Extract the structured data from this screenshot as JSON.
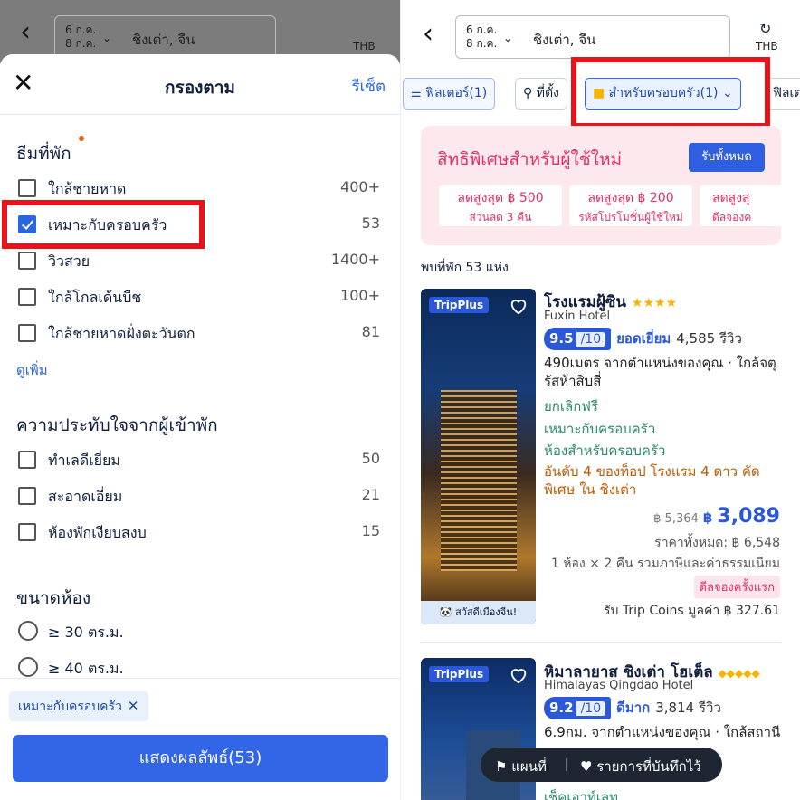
{
  "left": {
    "header": {
      "back": "‹",
      "date_line1": "6 ก.ค.",
      "date_line2": "8 ก.ค.",
      "city": "ชิงเต่า, จีน",
      "currency": "THB"
    },
    "sheet": {
      "title": "กรองตาม",
      "reset": "รีเซ็ต",
      "close": "✕",
      "theme": {
        "title": "ธีมที่พัก",
        "items": [
          {
            "label": "ใกล้ชายหาด",
            "count": "400+",
            "checked": false
          },
          {
            "label": "เหมาะกับครอบครัว",
            "count": "53",
            "checked": true
          },
          {
            "label": "วิวสวย",
            "count": "1400+",
            "checked": false
          },
          {
            "label": "ใกล้โกลเด้นบีช",
            "count": "100+",
            "checked": false
          },
          {
            "label": "ใกล้ชายหาดฝั่งตะวันตก",
            "count": "81",
            "checked": false
          }
        ],
        "more": "ดูเพิ่ม"
      },
      "impression": {
        "title": "ความประทับใจจากผู้เข้าพัก",
        "items": [
          {
            "label": "ทำเลดีเยี่ยม",
            "count": "50"
          },
          {
            "label": "สะอาดเอี่ยม",
            "count": "21"
          },
          {
            "label": "ห้องพักเงียบสงบ",
            "count": "15"
          }
        ]
      },
      "room_size": {
        "title": "ขนาดห้อง",
        "items": [
          {
            "label": "≥ 30 ตร.ม."
          },
          {
            "label": "≥ 40 ตร.ม."
          }
        ]
      },
      "selected_chip": {
        "label": "เหมาะกับครอบครัว",
        "remove": "✕"
      },
      "show_button": "แสดงผลลัพธ์(53)"
    }
  },
  "right": {
    "header": {
      "back": "‹",
      "date_line1": "6 ก.ค.",
      "date_line2": "8 ก.ค.",
      "city": "ชิงเต่า, จีน",
      "currency": "THB"
    },
    "chips": {
      "filter": "ฟิลเตอร์(1)",
      "location": "ที่ตั้ง",
      "family": "สำหรับครอบครัว(1)",
      "filter_cut": "ฟิลเต"
    },
    "promo": {
      "title": "สิทธิพิเศษสำหรับผู้ใช้ใหม่",
      "button": "รับทั้งหมด",
      "coupons": [
        {
          "amount": "ลดสูงสุด ฿ 500",
          "desc": "ส่วนลด 3 คืน"
        },
        {
          "amount": "ลดสูงสุด ฿ 200",
          "desc": "รหัสโปรโมชั่นผู้ใช้ใหม่"
        },
        {
          "amount": "ลดสูงสุ",
          "desc": "ดีลจองค"
        }
      ]
    },
    "found_text": "พบที่พัก 53 แห่ง",
    "hotels": [
      {
        "badge": "TripPlus",
        "name": "โรงแรมฝู้ซิน",
        "stars": "★★★★",
        "name_en": "Fuxin Hotel",
        "score": "9.5",
        "score_of": "/10",
        "score_word": "ยอดเยี่ยม",
        "reviews": "4,585 รีวิว",
        "distance": "490เมตร จากตำแหน่งของคุณ · ใกล้จตุรัสห้าสิบสี่",
        "free_cancel": "ยกเลิกฟรี",
        "family": "เหมาะกับครอบครัว",
        "family_room": "ห้องสำหรับครอบครัว",
        "rank": "อันดับ 4 ของท็อป โรงแรม 4 ดาว คัดพิเศษ ใน ชิงเต่า",
        "old_price": "฿ 5,364",
        "price_cur": "฿",
        "price": "3,089",
        "total": "ราคาทั้งหมด: ฿ 6,548",
        "stay": "1 ห้อง × 2 คืน รวมภาษีและค่าธรรมเนียม",
        "tag": "ดีลจองครั้งแรก",
        "coins": "รับ Trip Coins มูลค่า ฿ 327.61",
        "img_caption": "🐼 สวัสดีเมืองจีน!"
      },
      {
        "badge": "TripPlus",
        "name": "หิมาลายาส ชิงเต่า โฮเต็ล",
        "stars": "◆◆◆◆◆",
        "name_en": "Himalayas Qingdao Hotel",
        "score": "9.2",
        "score_of": "/10",
        "score_word": "ดีมาก",
        "reviews": "3,814 รีวิว",
        "distance": "6.9กม. จากตำแหน่งของคุณ · ใกล้สถานี",
        "checkout": "เช็คเอาท์เลท"
      }
    ],
    "floating": {
      "map": "แผนที่",
      "saved": "รายการที่บันทึกไว้"
    }
  }
}
